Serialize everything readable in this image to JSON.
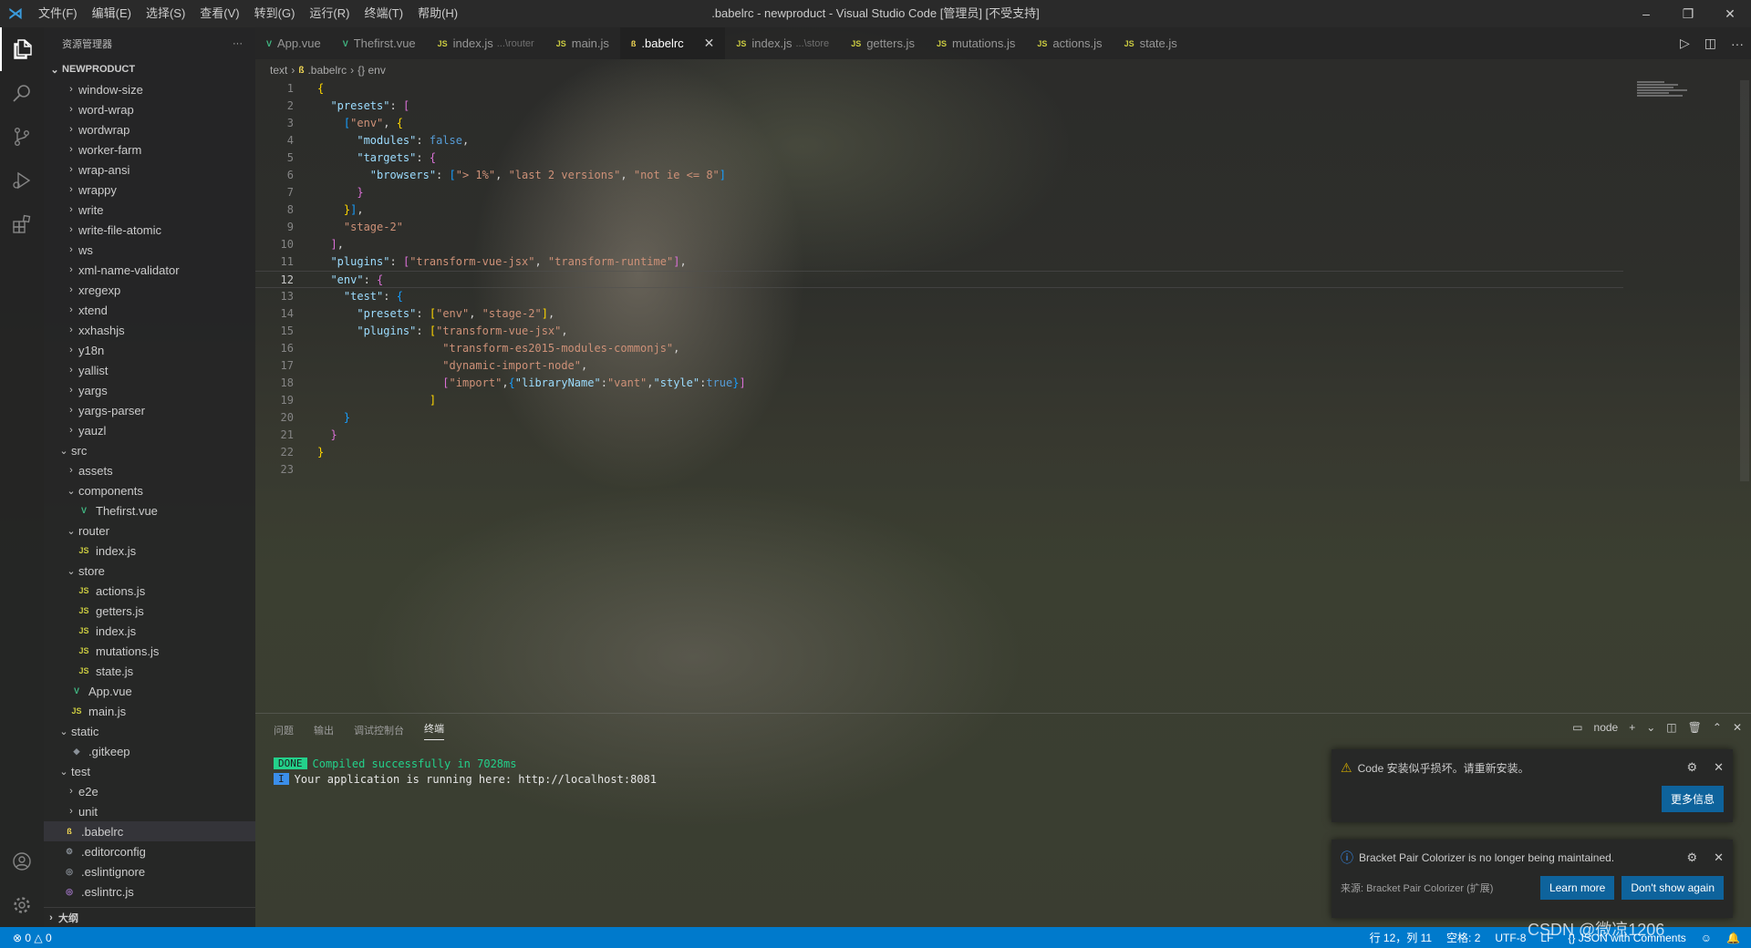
{
  "titlebar": {
    "menu": [
      "文件(F)",
      "编辑(E)",
      "选择(S)",
      "查看(V)",
      "转到(G)",
      "运行(R)",
      "终端(T)",
      "帮助(H)"
    ],
    "title": ".babelrc - newproduct - Visual Studio Code [管理员] [不受支持]",
    "controls": [
      "–",
      "❐",
      "✕"
    ]
  },
  "sidebar": {
    "title": "资源管理器",
    "more": "···",
    "root": "NEWPRODUCT",
    "items": [
      {
        "label": "window-size",
        "type": "folder",
        "open": false,
        "depth": 1
      },
      {
        "label": "word-wrap",
        "type": "folder",
        "open": false,
        "depth": 1
      },
      {
        "label": "wordwrap",
        "type": "folder",
        "open": false,
        "depth": 1
      },
      {
        "label": "worker-farm",
        "type": "folder",
        "open": false,
        "depth": 1
      },
      {
        "label": "wrap-ansi",
        "type": "folder",
        "open": false,
        "depth": 1
      },
      {
        "label": "wrappy",
        "type": "folder",
        "open": false,
        "depth": 1
      },
      {
        "label": "write",
        "type": "folder",
        "open": false,
        "depth": 1
      },
      {
        "label": "write-file-atomic",
        "type": "folder",
        "open": false,
        "depth": 1
      },
      {
        "label": "ws",
        "type": "folder",
        "open": false,
        "depth": 1
      },
      {
        "label": "xml-name-validator",
        "type": "folder",
        "open": false,
        "depth": 1
      },
      {
        "label": "xregexp",
        "type": "folder",
        "open": false,
        "depth": 1
      },
      {
        "label": "xtend",
        "type": "folder",
        "open": false,
        "depth": 1
      },
      {
        "label": "xxhashjs",
        "type": "folder",
        "open": false,
        "depth": 1
      },
      {
        "label": "y18n",
        "type": "folder",
        "open": false,
        "depth": 1
      },
      {
        "label": "yallist",
        "type": "folder",
        "open": false,
        "depth": 1
      },
      {
        "label": "yargs",
        "type": "folder",
        "open": false,
        "depth": 1
      },
      {
        "label": "yargs-parser",
        "type": "folder",
        "open": false,
        "depth": 1
      },
      {
        "label": "yauzl",
        "type": "folder",
        "open": false,
        "depth": 1
      },
      {
        "label": "src",
        "type": "folder",
        "open": true,
        "depth": 0
      },
      {
        "label": "assets",
        "type": "folder",
        "open": false,
        "depth": 1
      },
      {
        "label": "components",
        "type": "folder",
        "open": true,
        "depth": 1
      },
      {
        "label": "Thefirst.vue",
        "type": "vue",
        "depth": 2
      },
      {
        "label": "router",
        "type": "folder",
        "open": true,
        "depth": 1
      },
      {
        "label": "index.js",
        "type": "js",
        "depth": 2
      },
      {
        "label": "store",
        "type": "folder",
        "open": true,
        "depth": 1
      },
      {
        "label": "actions.js",
        "type": "js",
        "depth": 2
      },
      {
        "label": "getters.js",
        "type": "js",
        "depth": 2
      },
      {
        "label": "index.js",
        "type": "js",
        "depth": 2
      },
      {
        "label": "mutations.js",
        "type": "js",
        "depth": 2
      },
      {
        "label": "state.js",
        "type": "js",
        "depth": 2
      },
      {
        "label": "App.vue",
        "type": "vue",
        "depth": 1
      },
      {
        "label": "main.js",
        "type": "js",
        "depth": 1
      },
      {
        "label": "static",
        "type": "folder",
        "open": true,
        "depth": 0
      },
      {
        "label": ".gitkeep",
        "type": "git",
        "depth": 1
      },
      {
        "label": "test",
        "type": "folder",
        "open": true,
        "depth": 0
      },
      {
        "label": "e2e",
        "type": "folder",
        "open": false,
        "depth": 1
      },
      {
        "label": "unit",
        "type": "folder",
        "open": false,
        "depth": 1
      },
      {
        "label": ".babelrc",
        "type": "babel",
        "depth": 0,
        "selected": true
      },
      {
        "label": ".editorconfig",
        "type": "gear",
        "depth": 0
      },
      {
        "label": ".eslintignore",
        "type": "eslint-dim",
        "depth": 0
      },
      {
        "label": ".eslintrc.js",
        "type": "eslint",
        "depth": 0
      }
    ],
    "outline": "大纲"
  },
  "tabs": [
    {
      "label": "App.vue",
      "icon": "vue",
      "desc": ""
    },
    {
      "label": "Thefirst.vue",
      "icon": "vue",
      "desc": ""
    },
    {
      "label": "index.js",
      "icon": "js",
      "desc": "...\\router"
    },
    {
      "label": "main.js",
      "icon": "js",
      "desc": ""
    },
    {
      "label": ".babelrc",
      "icon": "babel",
      "desc": "",
      "active": true
    },
    {
      "label": "index.js",
      "icon": "js",
      "desc": "...\\store"
    },
    {
      "label": "getters.js",
      "icon": "js",
      "desc": ""
    },
    {
      "label": "mutations.js",
      "icon": "js",
      "desc": ""
    },
    {
      "label": "actions.js",
      "icon": "js",
      "desc": ""
    },
    {
      "label": "state.js",
      "icon": "js",
      "desc": ""
    }
  ],
  "breadcrumb": {
    "root": "text",
    "file": ".babelrc",
    "symbol": "{} env"
  },
  "editor": {
    "current_line": 12,
    "lines": [
      "{",
      "  \"presets\": [",
      "    [\"env\", {",
      "      \"modules\": false,",
      "      \"targets\": {",
      "        \"browsers\": [\"> 1%\", \"last 2 versions\", \"not ie <= 8\"]",
      "      }",
      "    }],",
      "    \"stage-2\"",
      "  ],",
      "  \"plugins\": [\"transform-vue-jsx\", \"transform-runtime\"],",
      "  \"env\": {",
      "    \"test\": {",
      "      \"presets\": [\"env\", \"stage-2\"],",
      "      \"plugins\": [\"transform-vue-jsx\",",
      "                   \"transform-es2015-modules-commonjs\",",
      "                   \"dynamic-import-node\",",
      "                   [\"import\",{\"libraryName\":\"vant\",\"style\":true}]",
      "                 ]",
      "    }",
      "  }",
      "}",
      ""
    ]
  },
  "panel": {
    "tabs": [
      "问题",
      "输出",
      "调试控制台",
      "终端"
    ],
    "active_tab": "终端",
    "terminal_name": "node",
    "terminal": [
      {
        "tag": "DONE",
        "text": "Compiled successfully in 7028ms"
      },
      {
        "tag": "I",
        "text": "Your application is running here: http://localhost:8081"
      }
    ]
  },
  "notifications": [
    {
      "text": "Code 安装似乎损坏。请重新安装。",
      "icon": "warning-icon",
      "buttons": [
        "更多信息"
      ],
      "source": ""
    },
    {
      "text": "Bracket Pair Colorizer is no longer being maintained.",
      "icon": "info-icon",
      "buttons": [
        "Learn more",
        "Don't show again"
      ],
      "source": "来源: Bracket Pair Colorizer (扩展)"
    }
  ],
  "statusbar": {
    "errors": "⊗ 0 △ 0",
    "position": "行 12，列 11",
    "spaces": "空格: 2",
    "encoding": "UTF-8",
    "eol": "LF",
    "language": "{} JSON with Comments"
  },
  "watermark": "CSDN @微凉1206",
  "colors": {
    "accent": "#007acc",
    "button": "#0e639c",
    "done": "#23d18b",
    "info": "#3b8eea"
  }
}
